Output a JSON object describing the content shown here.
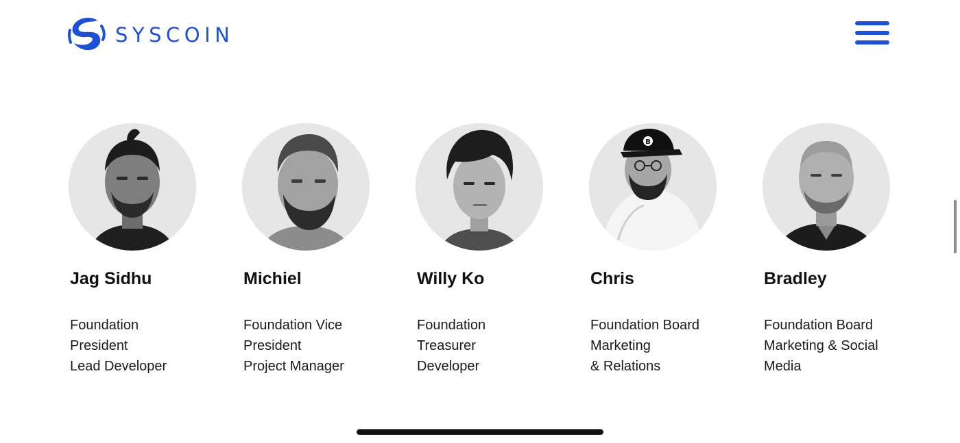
{
  "brand": {
    "name": "SYSCOIN",
    "logo_icon": "syscoin-logo-icon",
    "accent_color": "#1e50d4"
  },
  "header": {
    "menu_icon": "hamburger-menu-icon"
  },
  "team": [
    {
      "name": "Jag Sidhu",
      "role_lines": [
        "Foundation",
        "President",
        "Lead Developer"
      ]
    },
    {
      "name": "Michiel",
      "role_lines": [
        "Foundation Vice",
        "President",
        "Project Manager"
      ]
    },
    {
      "name": "Willy Ko",
      "role_lines": [
        "Foundation",
        "Treasurer",
        "Developer"
      ]
    },
    {
      "name": "Chris",
      "role_lines": [
        "Foundation Board",
        "Marketing",
        "& Relations"
      ]
    },
    {
      "name": "Bradley",
      "role_lines": [
        "Foundation Board",
        "Marketing & Social",
        "Media"
      ]
    }
  ]
}
